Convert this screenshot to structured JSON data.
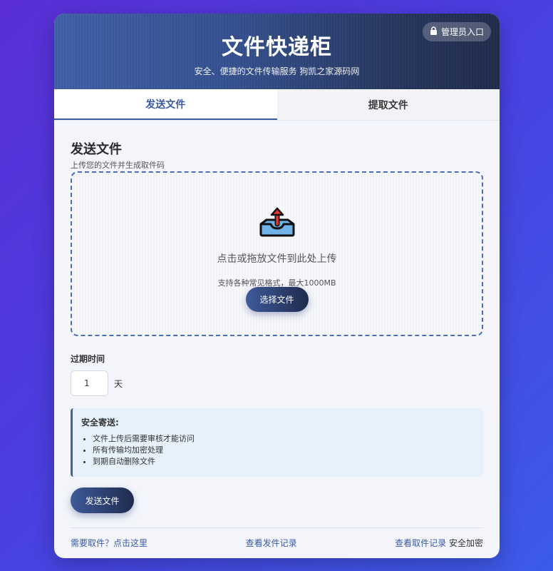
{
  "header": {
    "title": "文件快递柜",
    "subtitle": "安全、便捷的文件传输服务 狗凯之家源码网",
    "admin_label": "管理员入口"
  },
  "tabs": [
    {
      "label": "发送文件",
      "active": true
    },
    {
      "label": "提取文件",
      "active": false
    }
  ],
  "send": {
    "title": "发送文件",
    "description": "上传您的文件并生成取件码",
    "drop_text": "点击或拖放文件到此处上传",
    "drop_hint": "支持各种常见格式，最大1000MB",
    "choose_label": "选择文件",
    "expire_label": "过期时间",
    "expire_value": "1",
    "expire_unit": "天",
    "notice_title": "安全寄送:",
    "notice_items": [
      "文件上传后需要审核才能访问",
      "所有传输均加密处理",
      "到期自动删除文件"
    ],
    "send_label": "发送文件"
  },
  "footer": {
    "pickup_link": "需要取件？点击这里",
    "send_records": "查看发件记录",
    "pickup_records": "查看取件记录",
    "secure_text": "安全加密"
  },
  "colors": {
    "accent": "#3b5aa6",
    "button_dark": "#1f2b4d",
    "notice_bg": "#e6f1fb"
  },
  "icons": {
    "admin": "lock-icon",
    "upload": "upload-tray-icon"
  }
}
